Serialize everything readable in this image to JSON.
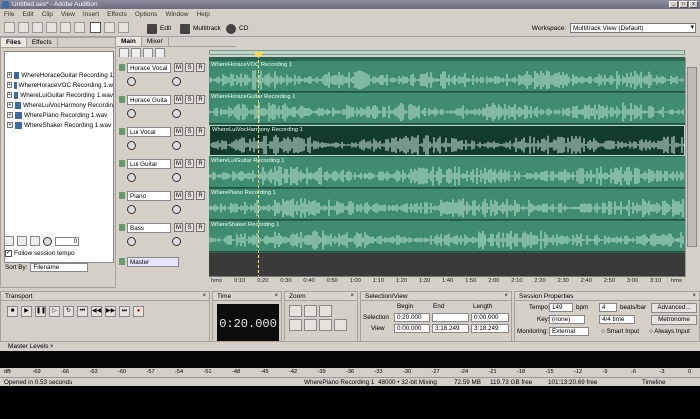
{
  "window": {
    "title": "Untitled.ses* - Adobe Audition"
  },
  "menu": [
    "File",
    "Edit",
    "Clip",
    "View",
    "Insert",
    "Effects",
    "Options",
    "Window",
    "Help"
  ],
  "toolbar": {
    "edit_label": "Edit",
    "multitrack_label": "Multitrack",
    "cd_label": "CD",
    "workspace_label": "Workspace:",
    "workspace_value": "Multitrack View (Default)"
  },
  "files_panel": {
    "tabs": [
      "Files",
      "Effects"
    ],
    "files": [
      "WhereHoraceGuitar Recording 1",
      "WhereHoraceVOC Recording 1.w",
      "WhereLuiGuitar Recording 1.wav",
      "WhereLuiVocHarmony Recordin",
      "WherePiano Recording 1.wav",
      "WhereShaker Recording 1.wav"
    ],
    "volume_value": "0",
    "follow_tempo": "Follow session tempo",
    "sort_by_label": "Sort By:",
    "sort_by_value": "Filename"
  },
  "editor": {
    "tabs": [
      "Main",
      "Mixer"
    ],
    "tracks": [
      {
        "name": "Horace Vocal",
        "clip": "WhereHoraceVOC Recording 1"
      },
      {
        "name": "Horace Guita",
        "clip": "WhereHoraceGuitar Recording 1"
      },
      {
        "name": "Lui Vocal",
        "clip": "WhereLuiVocHarmony Recording 1"
      },
      {
        "name": "Lui Guitar",
        "clip": "WhereLuiGuitar Recording 1"
      },
      {
        "name": "Piano",
        "clip": "WherePiano Recording 1"
      },
      {
        "name": "Bass",
        "clip": "WhereShaker Recording 1"
      }
    ],
    "master_label": "Master",
    "mute": "M",
    "solo": "S",
    "record": "R",
    "ruler": [
      "hms",
      "0:10",
      "0:20",
      "0:30",
      "0:40",
      "0:50",
      "1:00",
      "1:10",
      "1:20",
      "1:30",
      "1:40",
      "1:50",
      "2:00",
      "2:10",
      "2:20",
      "2:30",
      "2:40",
      "2:50",
      "3:00",
      "3:10",
      "hms"
    ]
  },
  "transport": {
    "title": "Transport"
  },
  "time": {
    "title": "Time",
    "value": "0:20.000"
  },
  "zoom": {
    "title": "Zoom"
  },
  "selection": {
    "title": "Selection/View",
    "headers": [
      "Begin",
      "End",
      "Length"
    ],
    "rows": [
      {
        "label": "Selection",
        "begin": "0:20.000",
        "end": "",
        "length": "0:00.000"
      },
      {
        "label": "View",
        "begin": "0:00.000",
        "end": "3:18.249",
        "length": "3:18.249"
      }
    ]
  },
  "session": {
    "title": "Session Properties",
    "tempo_label": "Tempo:",
    "tempo_value": "149",
    "bpm": "bpm",
    "beats_value": "4",
    "beats_label": "beats/bar",
    "advanced": "Advanced...",
    "key_label": "Key:",
    "key_value": "(none)",
    "time_sig": "4/4 time",
    "metronome": "Metronome",
    "monitoring_label": "Monitoring:",
    "monitoring_value": "External",
    "smart_input": "Smart Input",
    "always_input": "Always Input"
  },
  "master_levels": {
    "title": "Master Levels",
    "scale": [
      "dB",
      "-69",
      "-66",
      "-63",
      "-60",
      "-57",
      "-54",
      "-51",
      "-48",
      "-45",
      "-42",
      "-39",
      "-36",
      "-33",
      "-30",
      "-27",
      "-24",
      "-21",
      "-18",
      "-15",
      "-12",
      "-9",
      "-6",
      "-3",
      "0"
    ]
  },
  "status": {
    "opened": "Opened in 0.53 seconds",
    "file": "WherePiano Recording 1",
    "format": "48000 • 32-bit Mixing",
    "mem": "72.59 MB",
    "disk": "119.73 GB free",
    "time_free": "101:13:20.69 free",
    "timeline": "Timeline"
  }
}
